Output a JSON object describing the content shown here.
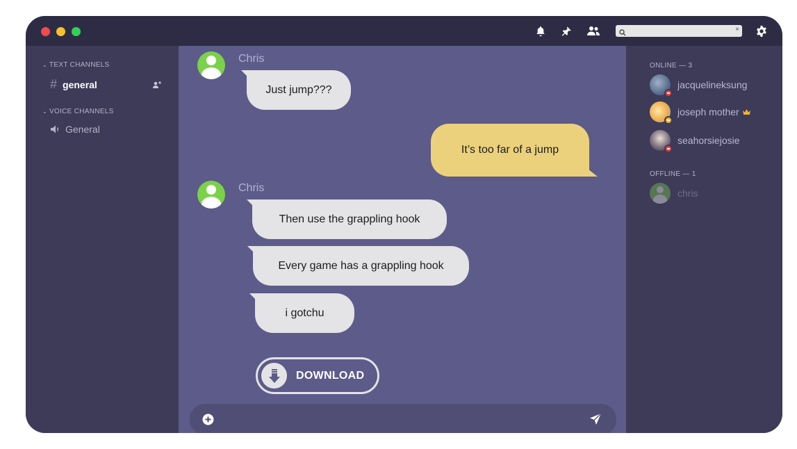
{
  "window": {
    "traffic_lights": [
      "close",
      "minimize",
      "maximize"
    ],
    "colors": {
      "close": "#f24b4b",
      "minimize": "#f7c12a",
      "maximize": "#31d157"
    }
  },
  "toolbar": {
    "icons": [
      "bell-icon",
      "pin-icon",
      "members-icon",
      "gear-icon"
    ],
    "search": {
      "value": "",
      "placeholder": ""
    }
  },
  "sidebar": {
    "text_category": "TEXT CHANNELS",
    "text_channel": "general",
    "voice_category": "VOICE CHANNELS",
    "voice_channel": "General"
  },
  "chat": {
    "messages": [
      {
        "sender": "Chris",
        "lines": [
          "Just jump???"
        ]
      },
      {
        "self": true,
        "text": "It’s too far of a jump"
      },
      {
        "sender": "Chris",
        "lines": [
          "Then use the grappling hook",
          "Every game has a grappling hook",
          "i gotchu"
        ]
      }
    ],
    "download_label": "DOWNLOAD",
    "composer": {
      "value": "",
      "placeholder": ""
    },
    "colors": {
      "incoming": "#e4e3e5",
      "outgoing": "#ecd17c",
      "background": "#5d5b8a"
    }
  },
  "members": {
    "online_header": "ONLINE — 3",
    "online": [
      {
        "name": "jacquelineksung",
        "status": "dnd"
      },
      {
        "name": "joseph mother",
        "status": "idle",
        "owner": true
      },
      {
        "name": "seahorsiejosie",
        "status": "dnd"
      }
    ],
    "offline_header": "OFFLINE — 1",
    "offline": [
      {
        "name": "chris"
      }
    ]
  }
}
